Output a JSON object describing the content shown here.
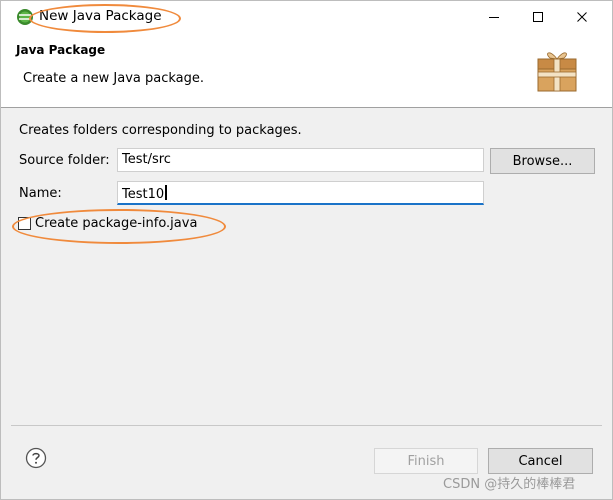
{
  "window": {
    "title": "New Java Package"
  },
  "banner": {
    "title": "Java Package",
    "message": "Create a new Java package."
  },
  "form": {
    "description": "Creates folders corresponding to packages.",
    "source_label": "Source folder:",
    "source_value": "Test/src",
    "browse_label": "Browse...",
    "name_label": "Name:",
    "name_value": "Test10",
    "checkbox_label": "Create package-info.java",
    "checkbox_checked": false
  },
  "footer": {
    "finish_label": "Finish",
    "finish_enabled": false,
    "cancel_label": "Cancel"
  },
  "watermark": "CSDN @持久的棒棒君",
  "colors": {
    "annotation": "#f08a3c",
    "focus": "#1a73c8"
  },
  "icons": [
    "eclipse-icon",
    "minimize-icon",
    "maximize-icon",
    "close-icon",
    "package-wizard-icon",
    "help-icon"
  ]
}
